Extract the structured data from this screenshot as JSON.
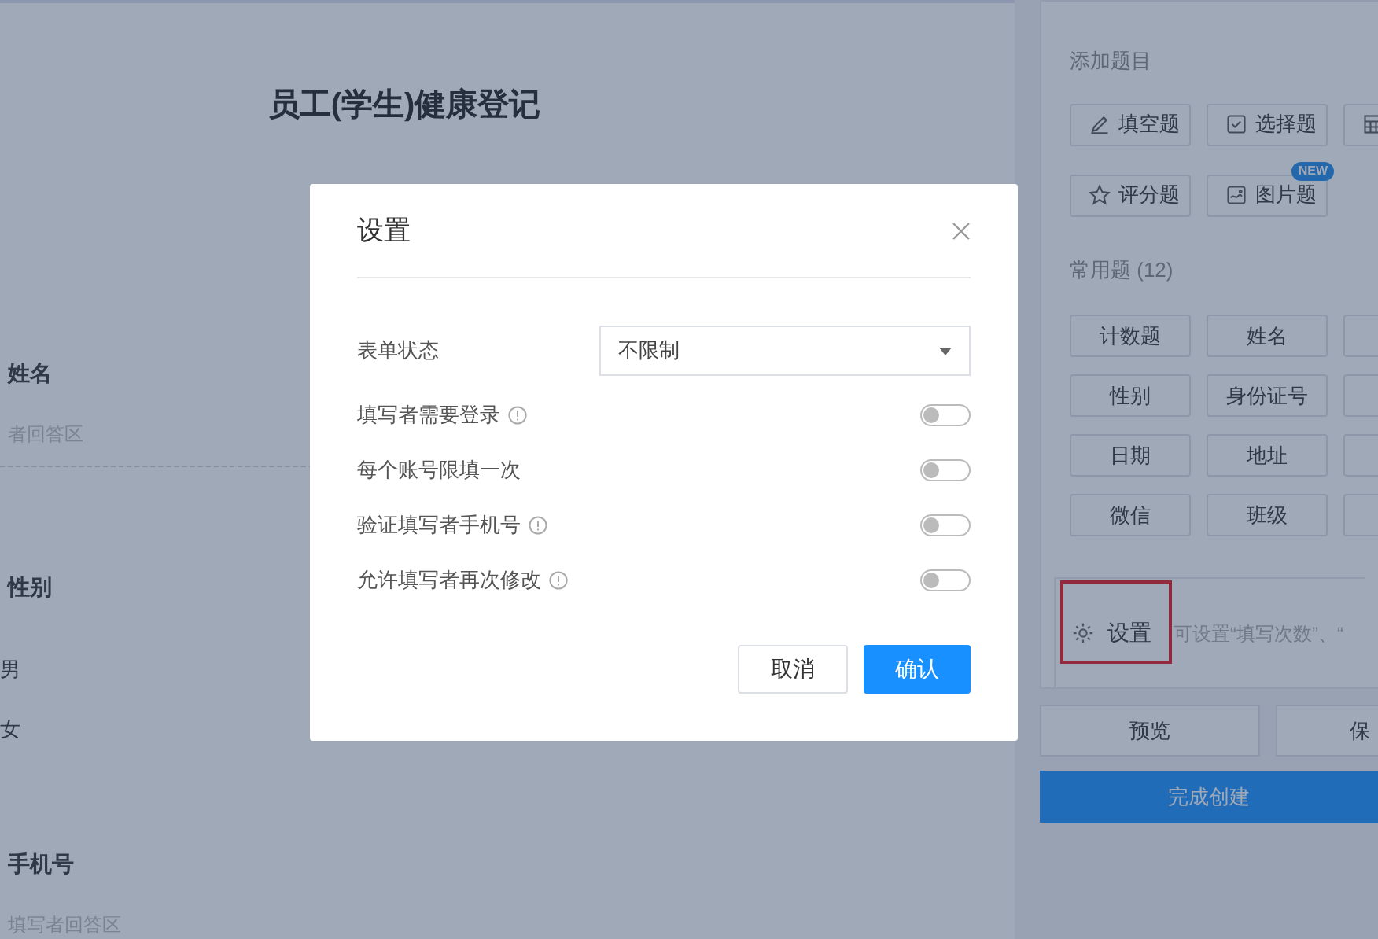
{
  "form": {
    "title": "员工(学生)健康登记",
    "questions": [
      {
        "kind": "text",
        "label": "姓名",
        "placeholder": "者回答区"
      },
      {
        "kind": "radio",
        "label": "性别",
        "options": [
          "男",
          "女"
        ]
      },
      {
        "kind": "text",
        "label": "手机号",
        "placeholder": "填写者回答区"
      }
    ]
  },
  "sidebar": {
    "add_heading": "添加题目",
    "add_rows": [
      [
        {
          "kind": "blank",
          "label": "填空题"
        },
        {
          "kind": "choice",
          "label": "选择题"
        },
        {
          "kind": "matrix"
        }
      ],
      [
        {
          "kind": "rating",
          "label": "评分题"
        },
        {
          "kind": "image",
          "label": "图片题",
          "badge": "NEW"
        }
      ]
    ],
    "common_heading": "常用题 (12)",
    "common_rows": [
      [
        "计数题",
        "姓名"
      ],
      [
        "性别",
        "身份证号"
      ],
      [
        "日期",
        "地址"
      ],
      [
        "微信",
        "班级"
      ]
    ],
    "settings": {
      "label": "设置",
      "hint": "可设置“填写次数”、“",
      "highlighted": true
    },
    "actions": [
      "预览",
      "保"
    ],
    "primary": "完成创建"
  },
  "dialog": {
    "title": "设置",
    "select": {
      "label": "表单状态",
      "value": "不限制"
    },
    "toggles": [
      {
        "label": "填写者需要登录",
        "info": true,
        "on": false
      },
      {
        "label": "每个账号限填一次",
        "info": false,
        "on": false
      },
      {
        "label": "验证填写者手机号",
        "info": true,
        "on": false
      },
      {
        "label": "允许填写者再次修改",
        "info": true,
        "on": false
      }
    ],
    "buttons": [
      "取消",
      "确认"
    ]
  }
}
